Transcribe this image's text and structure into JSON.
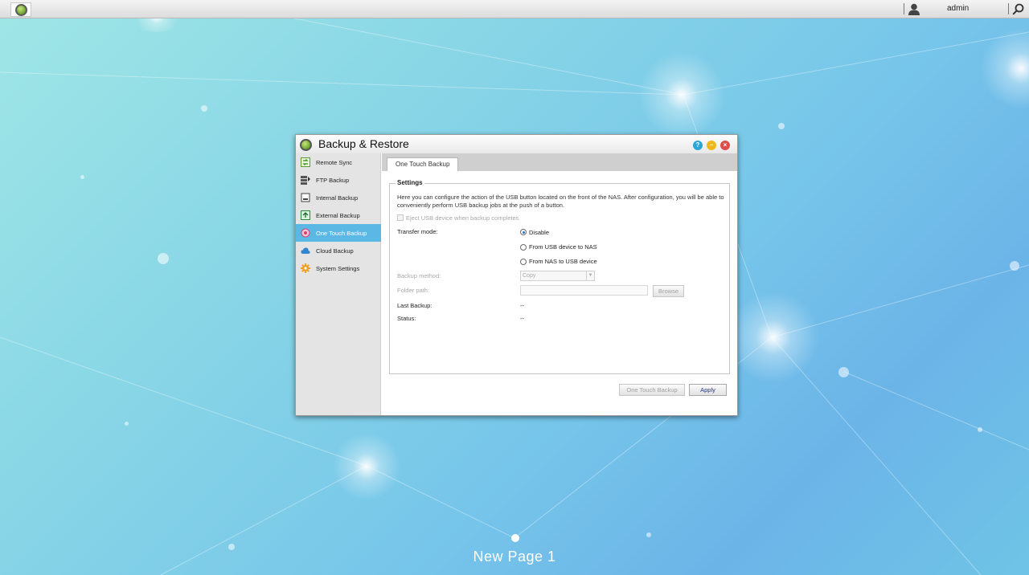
{
  "topbar": {
    "user": "admin"
  },
  "window": {
    "title": "Backup & Restore",
    "sidebar": {
      "items": [
        {
          "label": "Remote Sync",
          "icon": "sync-icon",
          "active": false
        },
        {
          "label": "FTP Backup",
          "icon": "ftp-icon",
          "active": false
        },
        {
          "label": "Internal Backup",
          "icon": "internal-disk-icon",
          "active": false
        },
        {
          "label": "External Backup",
          "icon": "external-disk-icon",
          "active": false
        },
        {
          "label": "One Touch Backup",
          "icon": "one-touch-icon",
          "active": true
        },
        {
          "label": "Cloud Backup",
          "icon": "cloud-icon",
          "active": false
        },
        {
          "label": "System Settings",
          "icon": "gear-icon",
          "active": false
        }
      ]
    },
    "tab": "One Touch Backup",
    "settings": {
      "legend": "Settings",
      "description": "Here you can configure the action of the USB button located on the front of the NAS. After configuration, you will be able to conveniently perform USB backup jobs at the push of a button.",
      "eject_label": "Eject USB device when backup completes",
      "transfer_mode_label": "Transfer mode:",
      "transfer_options": [
        "Disable",
        "From USB device to NAS",
        "From NAS to USB device"
      ],
      "transfer_selected": "Disable",
      "backup_method_label": "Backup method:",
      "backup_method_value": "Copy",
      "folder_path_label": "Folder path:",
      "browse_label": "Browse",
      "last_backup_label": "Last Backup:",
      "last_backup_value": "--",
      "status_label": "Status:",
      "status_value": "--"
    },
    "buttons": {
      "one_touch": "One Touch Backup",
      "apply": "Apply"
    }
  },
  "desktop": {
    "page_label": "New Page 1"
  },
  "colors": {
    "accent": "#5bb8e4",
    "help": "#2aa6d8",
    "minimize": "#f0b81a",
    "close": "#e24b4b"
  }
}
